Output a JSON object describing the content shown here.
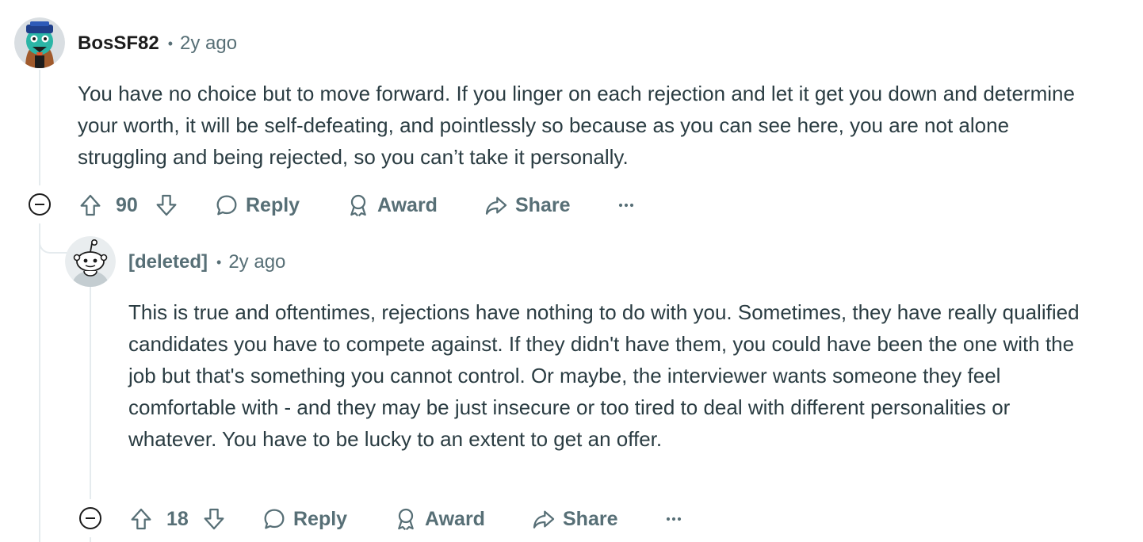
{
  "comments": [
    {
      "author": "BosSF82",
      "separator": "•",
      "time": "2y ago",
      "body": "You have no choice but to move forward. If you linger on each rejection and let it get you down and determine your worth, it will be self-defeating, and pointlessly so because as you can see here, you are not alone struggling and being rejected, so you can’t take it personally.",
      "votes": "90",
      "actions": {
        "reply": "Reply",
        "award": "Award",
        "share": "Share",
        "more": "···"
      }
    },
    {
      "author": "[deleted]",
      "separator": "•",
      "time": "2y ago",
      "body": "This is true and oftentimes, rejections have nothing to do with you. Sometimes, they have really qualified candidates you have to compete against. If they didn't have them, you could have been the one with the job but that's something you cannot control. Or maybe, the interviewer wants someone they feel comfortable with - and they may be just insecure or too tired to deal with different personalities or whatever. You have to be lucky to an extent to get an offer.",
      "votes": "18",
      "actions": {
        "reply": "Reply",
        "award": "Award",
        "share": "Share",
        "more": "···"
      }
    }
  ],
  "colors": {
    "text_primary": "#1c1c1c",
    "text_body": "#2a3c42",
    "text_meta": "#576f76",
    "thread_line": "#e5ebee"
  },
  "icons": [
    "upvote-icon",
    "downvote-icon",
    "reply-bubble-icon",
    "award-icon",
    "share-icon",
    "more-options-icon",
    "collapse-icon",
    "snoo-avatar-icon"
  ]
}
